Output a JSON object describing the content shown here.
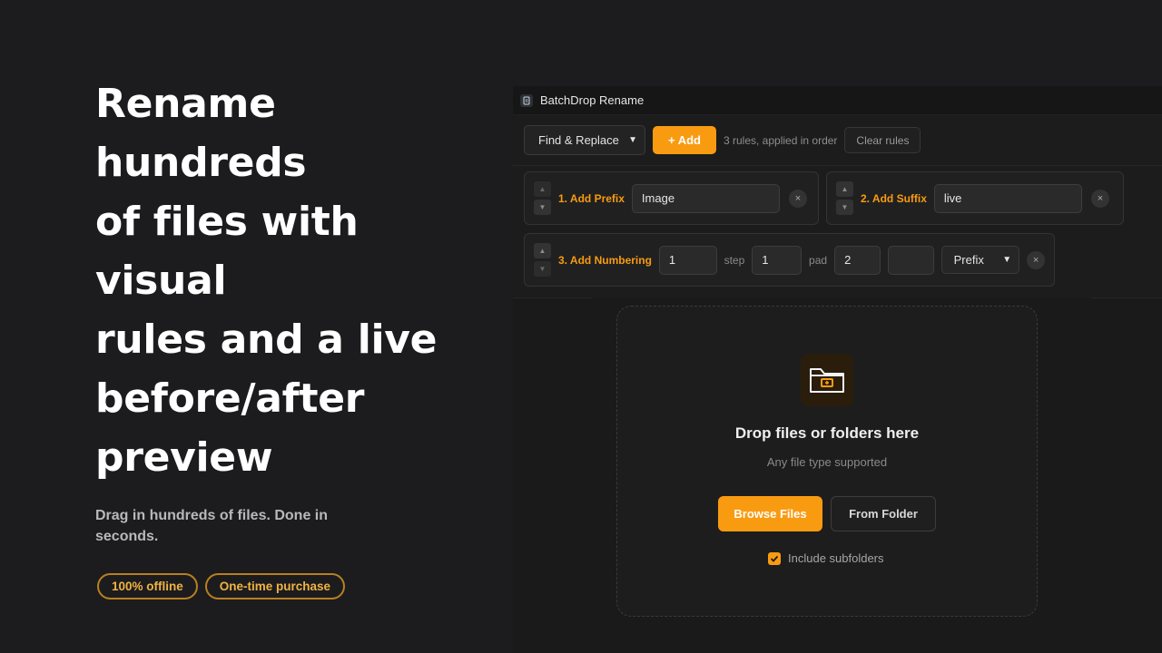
{
  "hero": {
    "headline_lines": [
      "Rename hundreds",
      "of files with visual",
      "rules and a live",
      "before/after",
      "preview"
    ],
    "subtext": "Drag in hundreds of files. Done in seconds.",
    "pills": [
      "100% offline",
      "One-time purchase"
    ]
  },
  "window": {
    "title": "BatchDrop Rename"
  },
  "toolbar": {
    "rule_type_selected": "Find & Replace",
    "add_label": "+ Add",
    "rules_count": "3 rules, applied in order",
    "clear_label": "Clear rules"
  },
  "rules": {
    "prefix": {
      "number": "1.",
      "name": "Add Prefix",
      "value": "Image"
    },
    "suffix": {
      "number": "2.",
      "name": "Add Suffix",
      "value": "live"
    },
    "numbering": {
      "number": "3.",
      "name": "Add Numbering",
      "start": "1",
      "step_label": "step",
      "step": "1",
      "pad_label": "pad",
      "pad": "2",
      "separator": "",
      "position": "Prefix"
    },
    "remove_symbol": "×"
  },
  "dropzone": {
    "heading": "Drop files or folders here",
    "subtext": "Any file type supported",
    "browse_label": "Browse Files",
    "folder_label": "From Folder",
    "include_subfolders_label": "Include subfolders",
    "include_subfolders_checked": true
  },
  "colors": {
    "accent": "#f99b11",
    "background": "#1c1c1e"
  }
}
